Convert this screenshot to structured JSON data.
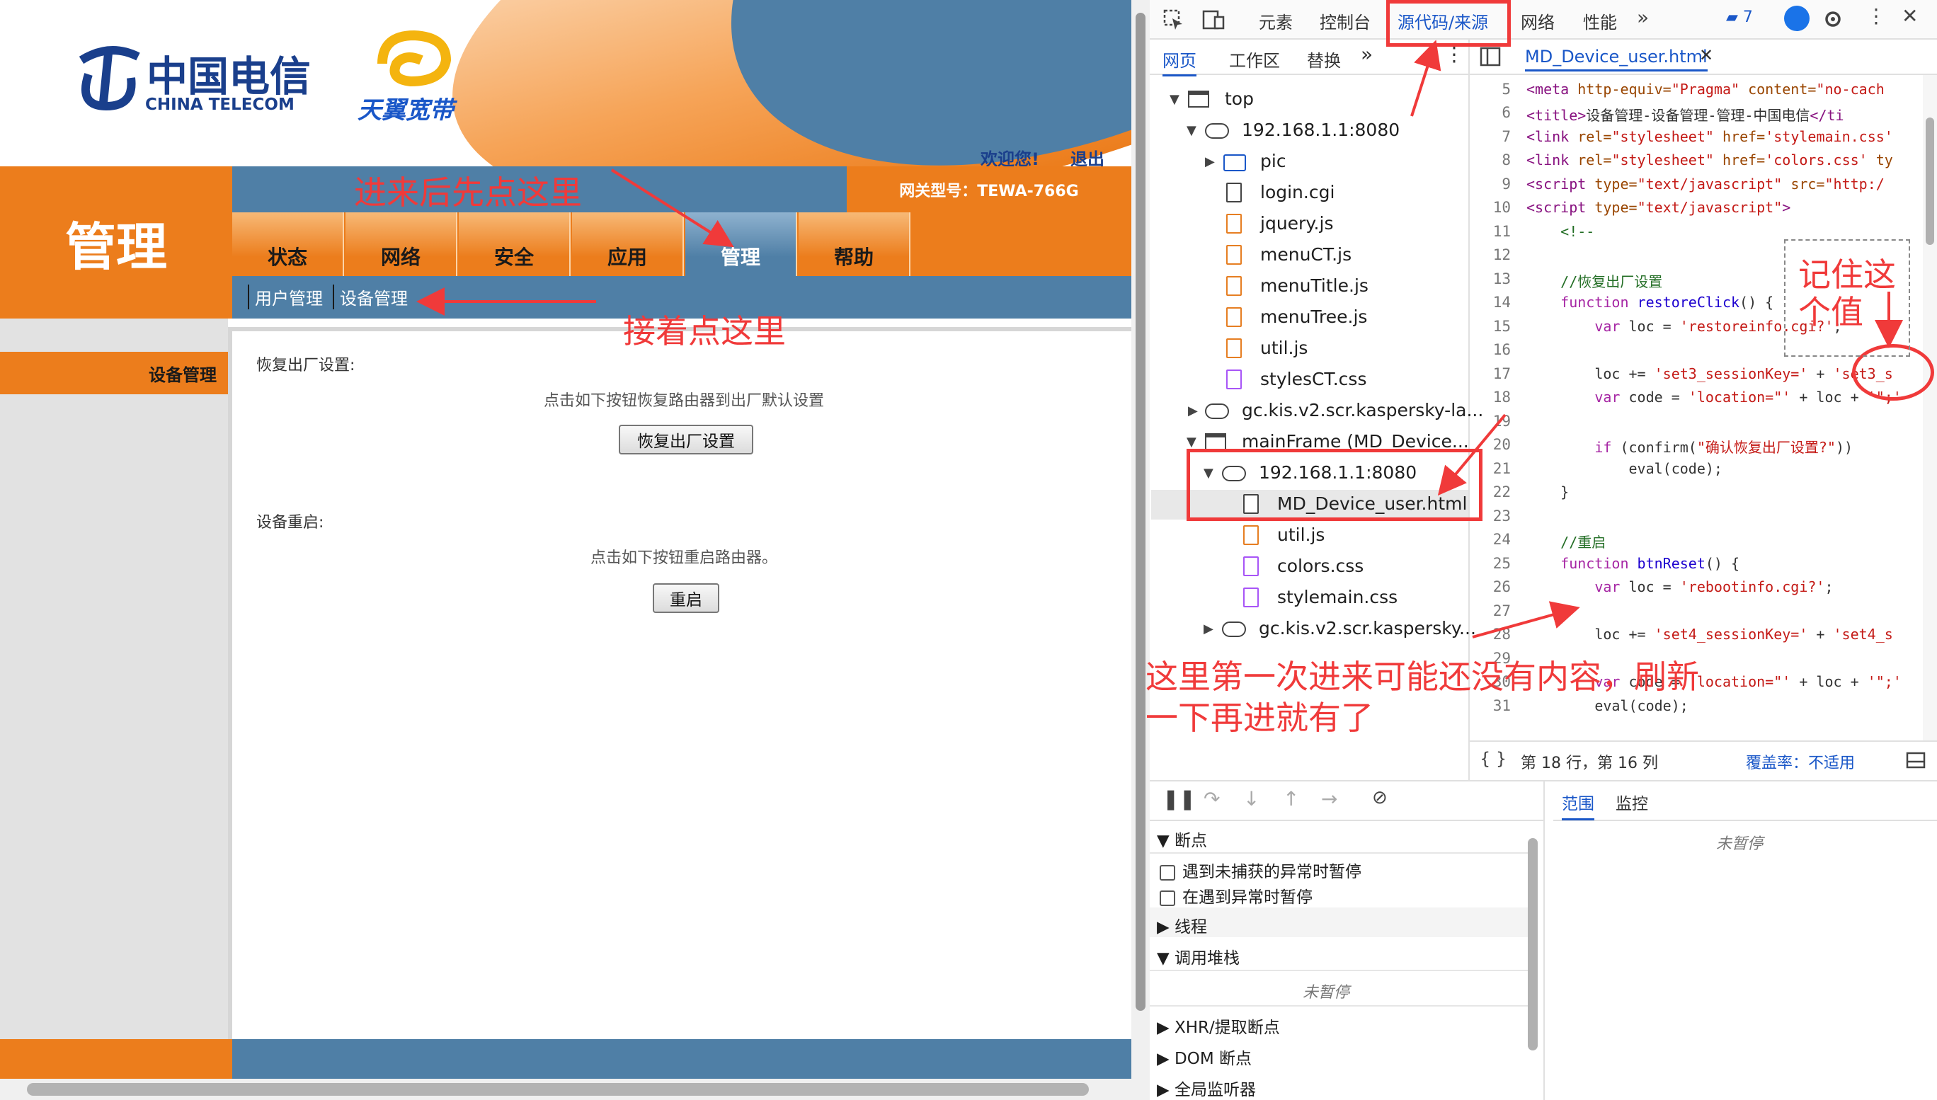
{
  "router": {
    "logo_ct_cn": "中国电信",
    "logo_ct_en": "CHINA TELECOM",
    "logo_ty": "天翼宽带",
    "welcome": "欢迎您!",
    "logout": "退出",
    "page_title": "管理",
    "gateway_model": "网关型号：TEWA-766G",
    "nav_tabs": [
      "状态",
      "网络",
      "安全",
      "应用",
      "管理",
      "帮助"
    ],
    "active_tab": "管理",
    "sub_nav": [
      "用户管理",
      "设备管理"
    ],
    "side_item": "设备管理",
    "restore_label": "恢复出厂设置:",
    "restore_desc": "点击如下按钮恢复路由器到出厂默认设置",
    "restore_button": "恢复出厂设置",
    "reboot_label": "设备重启:",
    "reboot_desc": "点击如下按钮重启路由器。",
    "reboot_button": "重启"
  },
  "devtools": {
    "tabs": [
      "元素",
      "控制台",
      "源代码/来源",
      "网络",
      "性能"
    ],
    "active_tab": "源代码/来源",
    "issues_count": "7",
    "nav_tabs": [
      "网页",
      "工作区",
      "替换"
    ],
    "tree": [
      {
        "label": "top",
        "kind": "frame"
      },
      {
        "label": "192.168.1.1:8080",
        "kind": "cloud"
      },
      {
        "label": "pic",
        "kind": "folder"
      },
      {
        "label": "login.cgi",
        "kind": "file"
      },
      {
        "label": "jquery.js",
        "kind": "js"
      },
      {
        "label": "menuCT.js",
        "kind": "js"
      },
      {
        "label": "menuTitle.js",
        "kind": "js"
      },
      {
        "label": "menuTree.js",
        "kind": "js"
      },
      {
        "label": "util.js",
        "kind": "js"
      },
      {
        "label": "stylesCT.css",
        "kind": "css"
      },
      {
        "label": "gc.kis.v2.scr.kaspersky-la...",
        "kind": "cloud"
      },
      {
        "label": "mainFrame (MD_Device...",
        "kind": "frame"
      },
      {
        "label": "192.168.1.1:8080",
        "kind": "cloud"
      },
      {
        "label": "MD_Device_user.html",
        "kind": "file"
      },
      {
        "label": "util.js",
        "kind": "js"
      },
      {
        "label": "colors.css",
        "kind": "css"
      },
      {
        "label": "stylemain.css",
        "kind": "css"
      },
      {
        "label": "gc.kis.v2.scr.kaspersky...",
        "kind": "cloud"
      }
    ],
    "open_file": "MD_Device_user.html",
    "line_numbers": [
      "5",
      "6",
      "7",
      "8",
      "9",
      "10",
      "11",
      "12",
      "13",
      "14",
      "15",
      "16",
      "17",
      "18",
      "19",
      "20",
      "21",
      "22",
      "23",
      "24",
      "25",
      "26",
      "27",
      "28",
      "29",
      "30",
      "31"
    ],
    "status_position": "第 18 行，第 16 列",
    "coverage": "覆盖率：不适用",
    "debug_sections": {
      "breakpoints": "断点",
      "pause_uncaught": "遇到未捕获的异常时暂停",
      "pause_caught": "在遇到异常时暂停",
      "threads": "线程",
      "call_stack": "调用堆栈",
      "not_paused": "未暂停",
      "xhr": "XHR/提取断点",
      "dom": "DOM 断点",
      "global": "全局监听器"
    },
    "scope_tabs": [
      "范围",
      "监控"
    ],
    "scope_not_paused": "未暂停"
  },
  "annotations": {
    "click_first": "进来后先点这里",
    "click_next": "接着点这里",
    "remember": "记住这个值",
    "refresh_note_1": "这里第一次进来可能还没有内容，刷新",
    "refresh_note_2": "一下再进就有了"
  }
}
